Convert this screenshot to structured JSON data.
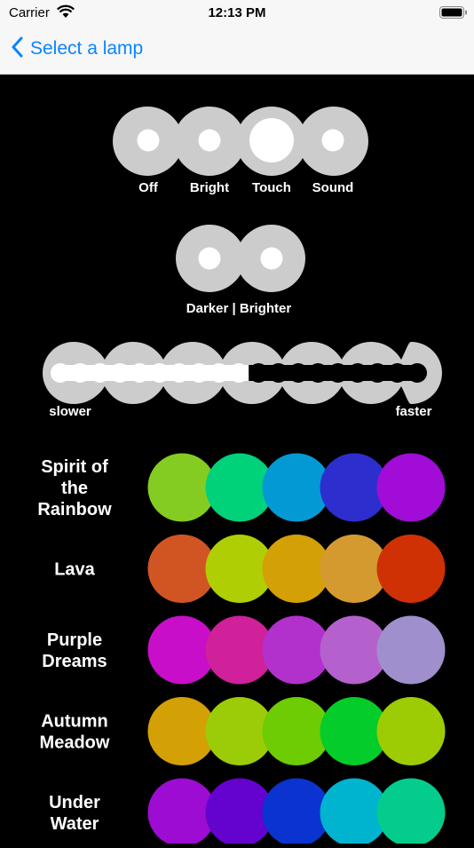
{
  "status_bar": {
    "carrier": "Carrier",
    "time": "12:13 PM"
  },
  "nav": {
    "back_label": "Select a lamp",
    "accent_color": "#0a84ff"
  },
  "modes": {
    "labels": [
      "Off",
      "Bright",
      "Touch",
      "Sound"
    ],
    "selected": "Touch"
  },
  "brightness": {
    "label": "Darker | Brighter"
  },
  "speed": {
    "slower_label": "slower",
    "faster_label": "faster",
    "level": 0.5
  },
  "palettes": [
    {
      "name_lines": [
        "Spirit of",
        "the",
        "Rainbow"
      ],
      "colors": [
        "#84cc22",
        "#00d27a",
        "#0399d4",
        "#2c2fce",
        "#a10cd6"
      ]
    },
    {
      "name_lines": [
        "Lava"
      ],
      "colors": [
        "#d05523",
        "#b0ce04",
        "#d3a006",
        "#d49a30",
        "#cf3105"
      ]
    },
    {
      "name_lines": [
        "Purple",
        "Dreams"
      ],
      "colors": [
        "#c80ec8",
        "#d0209a",
        "#b231cc",
        "#b561cd",
        "#a08fcd"
      ]
    },
    {
      "name_lines": [
        "Autumn",
        "Meadow"
      ],
      "colors": [
        "#d3a006",
        "#9ccc08",
        "#6dcc04",
        "#04cc2a",
        "#9dcc04"
      ]
    },
    {
      "name_lines": [
        "Under",
        "Water"
      ],
      "colors": [
        "#9c0cd2",
        "#6402ce",
        "#0a33cf",
        "#00b3ce",
        "#04cc8c"
      ]
    }
  ]
}
